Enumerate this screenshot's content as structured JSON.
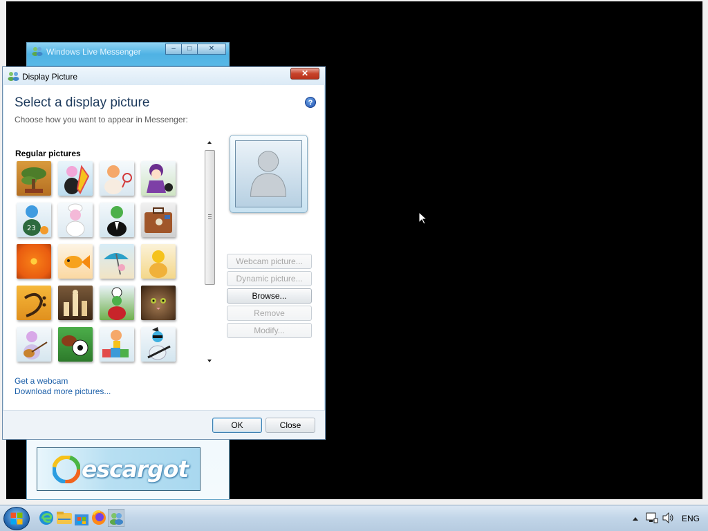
{
  "messenger_window": {
    "title": "Windows Live Messenger",
    "controls": [
      "–",
      "□",
      "✕"
    ],
    "banner_text": "escargot"
  },
  "dialog": {
    "title": "Display Picture",
    "close_label": "✕",
    "heading": "Select a display picture",
    "subheading": "Choose how you want to appear in Messenger:",
    "help_label": "?",
    "section_label": "Regular pictures",
    "pictures": [
      "bonsai-tree",
      "surfboard-buddy",
      "tennis-buddy",
      "girl-with-cat",
      "basketball-buddy",
      "chef-buddy",
      "suit-buddy",
      "suitcase",
      "orange-flower",
      "goldfish",
      "beach-umbrella",
      "sunny-buddy",
      "bass-clef",
      "chess-pieces",
      "soccer-buddy",
      "kitten",
      "guitar-buddy",
      "sports-balls",
      "blocks-buddy",
      "rocker-buddy"
    ],
    "buttons": {
      "webcam": "Webcam picture...",
      "dynamic": "Dynamic picture...",
      "browse": "Browse...",
      "remove": "Remove",
      "modify": "Modify..."
    },
    "links": {
      "get_webcam": "Get a webcam",
      "download": "Download more pictures..."
    },
    "ok_label": "OK",
    "cancel_label": "Close"
  },
  "taskbar": {
    "language": "ENG",
    "icons": [
      "start-orb",
      "edge-icon",
      "file-explorer-icon",
      "store-icon",
      "firefox-icon",
      "messenger-icon"
    ]
  }
}
